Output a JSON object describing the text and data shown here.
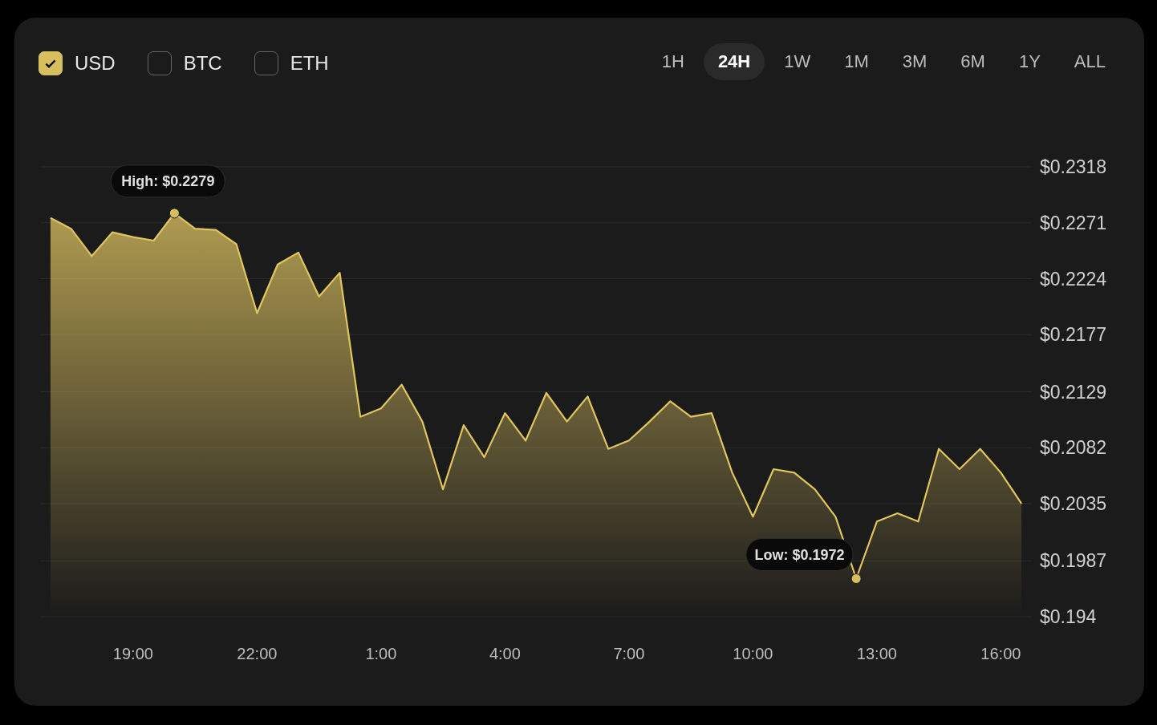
{
  "currencies": [
    {
      "label": "USD",
      "checked": true
    },
    {
      "label": "BTC",
      "checked": false
    },
    {
      "label": "ETH",
      "checked": false
    }
  ],
  "ranges": [
    {
      "label": "1H",
      "selected": false
    },
    {
      "label": "24H",
      "selected": true
    },
    {
      "label": "1W",
      "selected": false
    },
    {
      "label": "1M",
      "selected": false
    },
    {
      "label": "3M",
      "selected": false
    },
    {
      "label": "6M",
      "selected": false
    },
    {
      "label": "1Y",
      "selected": false
    },
    {
      "label": "ALL",
      "selected": false
    }
  ],
  "chart": {
    "chart_data": {
      "type": "area",
      "categories": [
        null,
        null,
        null,
        null,
        "19:00",
        null,
        null,
        null,
        null,
        null,
        "22:00",
        null,
        null,
        null,
        null,
        null,
        "1:00",
        null,
        null,
        null,
        null,
        null,
        "4:00",
        null,
        null,
        null,
        null,
        null,
        "7:00",
        null,
        null,
        null,
        null,
        null,
        "10:00",
        null,
        null,
        null,
        null,
        null,
        "13:00",
        null,
        null,
        null,
        null,
        null,
        "16:00",
        null
      ],
      "series": [
        {
          "color": "#e0c65c",
          "values": [
            0.2275,
            0.2266,
            0.2243,
            0.2263,
            0.2259,
            0.2256,
            0.2279,
            0.2266,
            0.2265,
            0.2253,
            0.2195,
            0.2236,
            0.2246,
            0.2209,
            0.2229,
            0.2108,
            0.2115,
            0.2135,
            0.2104,
            0.2047,
            0.2101,
            0.2074,
            0.2111,
            0.2088,
            0.2128,
            0.2104,
            0.2125,
            0.2081,
            0.2088,
            0.2104,
            0.2121,
            0.2108,
            0.2111,
            0.2061,
            0.2024,
            0.2064,
            0.2061,
            0.2047,
            0.2024,
            0.1972,
            0.202,
            0.2027,
            0.202,
            0.2081,
            0.2064,
            0.2081,
            0.2061,
            0.2035
          ]
        }
      ],
      "ylim": [
        0.194,
        0.2318
      ],
      "grid": true,
      "yticks": [
        {
          "value": 0.194,
          "label": "$0.194"
        },
        {
          "value": 0.1987,
          "label": "$0.1987"
        },
        {
          "value": 0.2035,
          "label": "$0.2035"
        },
        {
          "value": 0.2082,
          "label": "$0.2082"
        },
        {
          "value": 0.2129,
          "label": "$0.2129"
        },
        {
          "value": 0.2177,
          "label": "$0.2177"
        },
        {
          "value": 0.2224,
          "label": "$0.2224"
        },
        {
          "value": 0.2271,
          "label": "$0.2271"
        },
        {
          "value": 0.2318,
          "label": "$0.2318"
        }
      ],
      "annotations": [
        "High: $0.2279",
        "Low: $0.1972"
      ]
    }
  }
}
